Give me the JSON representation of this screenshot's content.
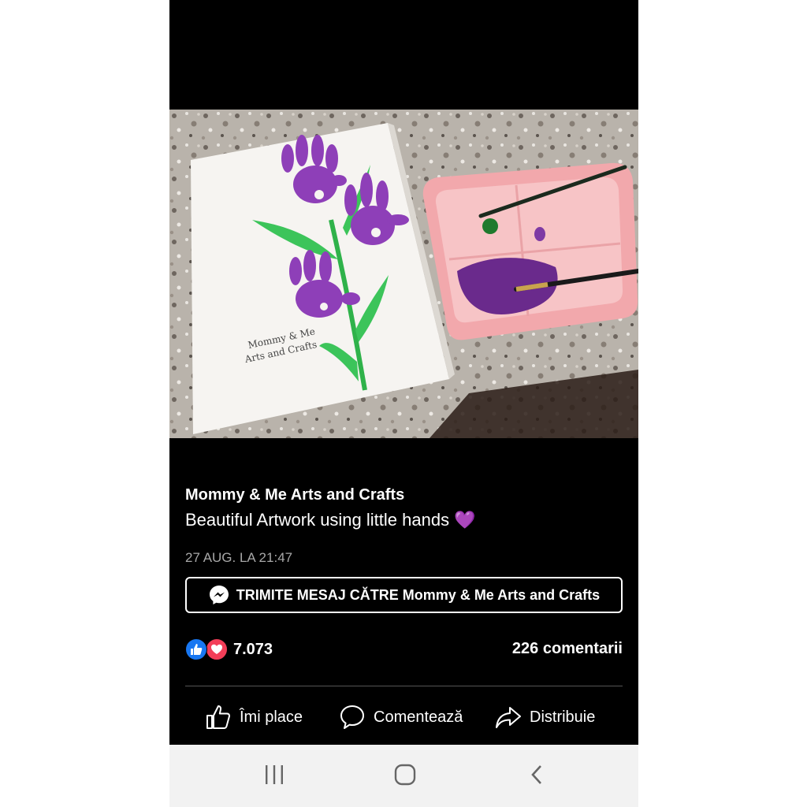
{
  "post": {
    "page_name": "Mommy & Me Arts and Crafts",
    "caption": "Beautiful Artwork using little hands",
    "caption_emoji": "💜",
    "date": "27 AUG. LA 21:47",
    "photo_overlay_text_line1": "Mommy & Me",
    "photo_overlay_text_line2": "Arts and Crafts"
  },
  "message_button": {
    "label": "TRIMITE MESAJ CĂTRE Mommy & Me Arts and Crafts",
    "icon": "messenger-icon"
  },
  "stats": {
    "reactions_count": "7.073",
    "reaction_icons": [
      "like-icon",
      "love-icon"
    ],
    "comments": "226 comentarii"
  },
  "actions": {
    "like": "Îmi place",
    "comment": "Comentează",
    "share": "Distribuie"
  },
  "navbar": {
    "icons": [
      "recent-apps-icon",
      "home-icon",
      "back-icon"
    ]
  },
  "colors": {
    "background": "#000000",
    "like_blue": "#1877f2",
    "love_red": "#f33e58",
    "navbar": "#f2f2f2"
  }
}
